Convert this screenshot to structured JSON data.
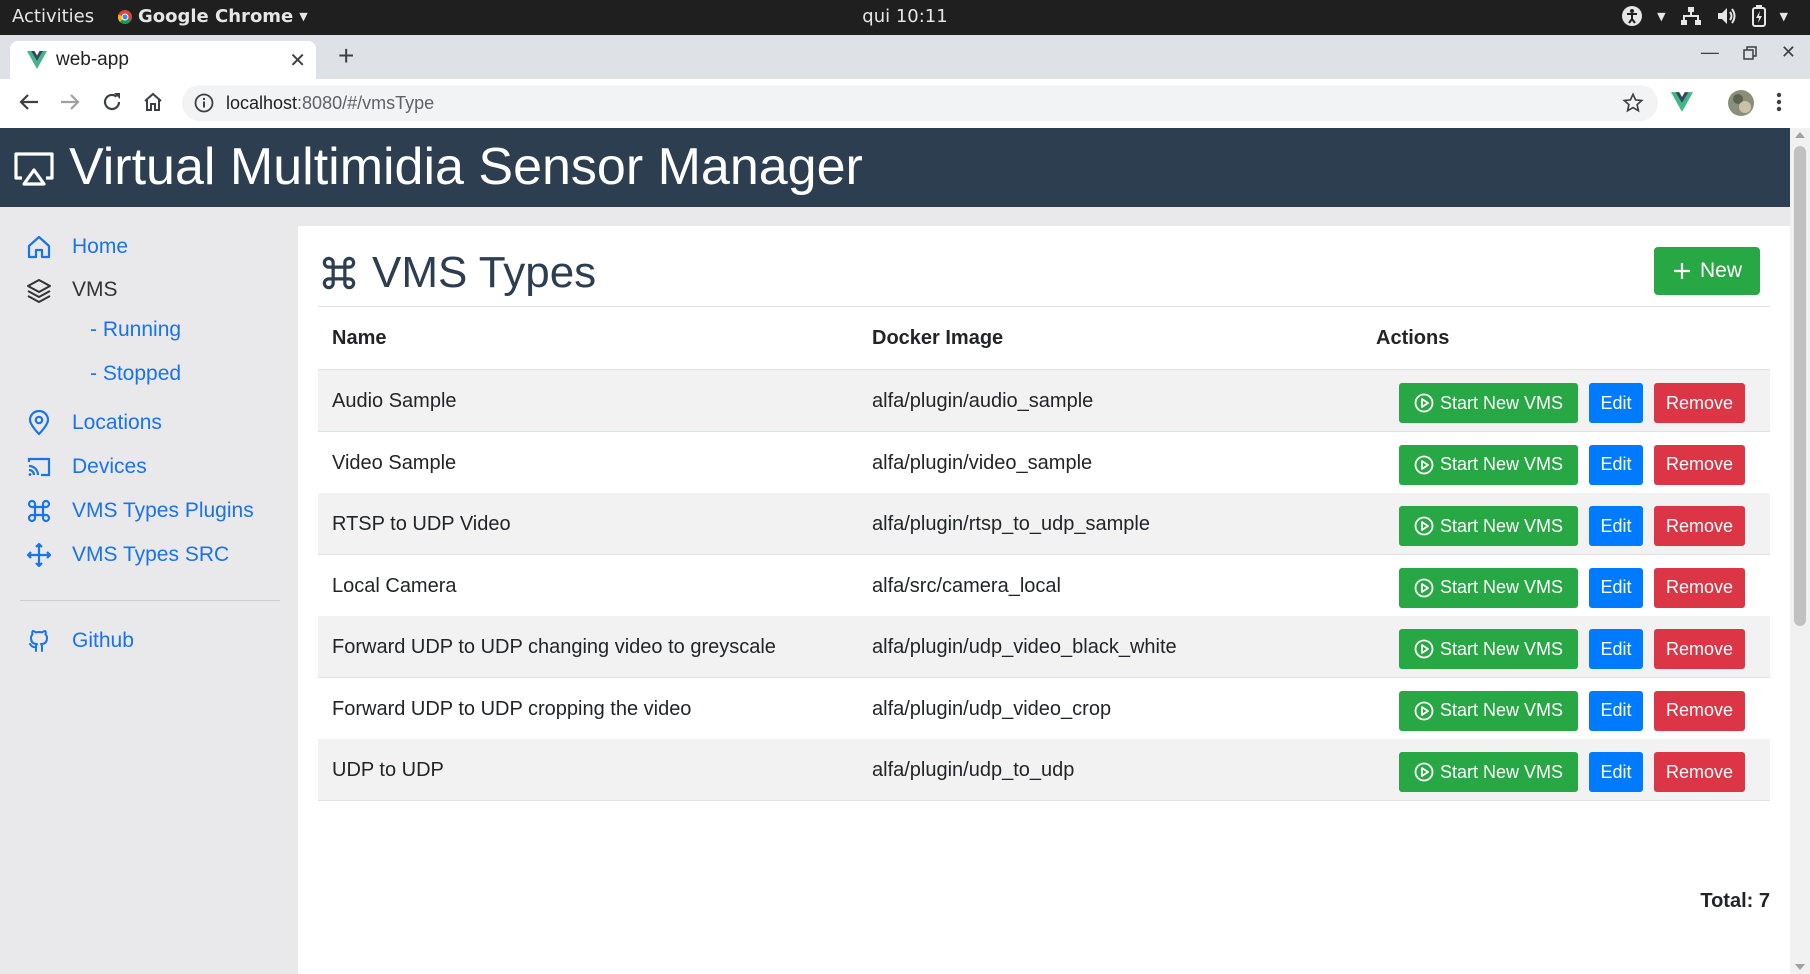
{
  "os_bar": {
    "activities": "Activities",
    "app_name": "Google Chrome",
    "clock": "qui 10:11"
  },
  "browser": {
    "tab_title": "web-app",
    "url_host": "localhost",
    "url_rest": ":8080/#/vmsType"
  },
  "app": {
    "title": "Virtual Multimidia Sensor Manager"
  },
  "sidebar": {
    "home": "Home",
    "vms": "VMS",
    "running": "- Running",
    "stopped": "- Stopped",
    "locations": "Locations",
    "devices": "Devices",
    "plugins": "VMS Types Plugins",
    "src": "VMS Types SRC",
    "github": "Github"
  },
  "page": {
    "title": "VMS Types",
    "new_button": "New",
    "columns": {
      "name": "Name",
      "image": "Docker Image",
      "actions": "Actions"
    },
    "row_actions": {
      "start": "Start New VMS",
      "edit": "Edit",
      "remove": "Remove"
    },
    "rows": [
      {
        "name": "Audio Sample",
        "image": "alfa/plugin/audio_sample"
      },
      {
        "name": "Video Sample",
        "image": "alfa/plugin/video_sample"
      },
      {
        "name": "RTSP to UDP Video",
        "image": "alfa/plugin/rtsp_to_udp_sample"
      },
      {
        "name": "Local Camera",
        "image": "alfa/src/camera_local"
      },
      {
        "name": "Forward UDP to UDP changing video to greyscale",
        "image": "alfa/plugin/udp_video_black_white"
      },
      {
        "name": "Forward UDP to UDP cropping the video",
        "image": "alfa/plugin/udp_video_crop"
      },
      {
        "name": "UDP to UDP",
        "image": "alfa/plugin/udp_to_udp"
      }
    ],
    "total": "Total: 7"
  },
  "colors": {
    "header": "#2c3e50",
    "success": "#28a745",
    "primary": "#007bff",
    "danger": "#dc3545",
    "link": "#1a73e8"
  }
}
